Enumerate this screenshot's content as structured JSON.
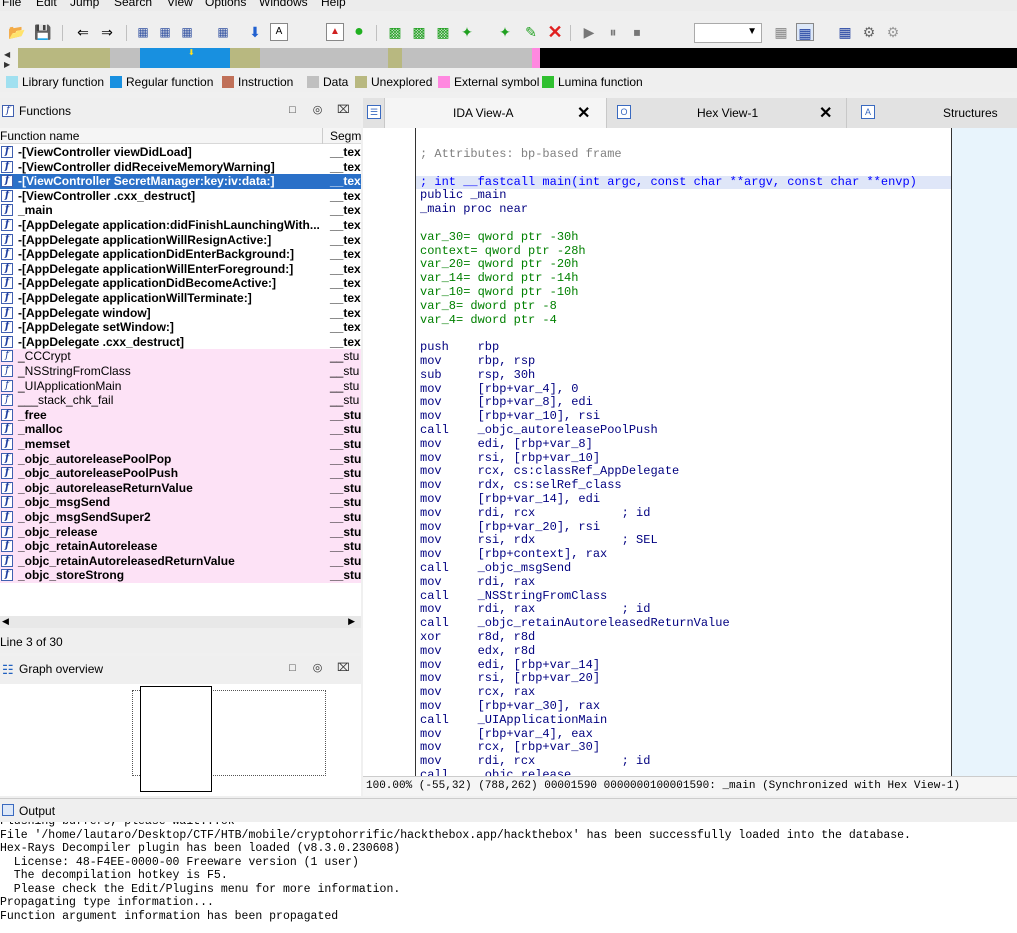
{
  "menu": [
    "File",
    "Edit",
    "Jump",
    "Search",
    "View",
    "Options",
    "Windows",
    "Help"
  ],
  "legend": [
    {
      "label": "Library function",
      "color": "#a0e0f0"
    },
    {
      "label": "Regular function",
      "color": "#1890e0"
    },
    {
      "label": "Instruction",
      "color": "#c07058"
    },
    {
      "label": "Data",
      "color": "#c0c0c0"
    },
    {
      "label": "Unexplored",
      "color": "#b8b880"
    },
    {
      "label": "External symbol",
      "color": "#ff88e0"
    },
    {
      "label": "Lumina function",
      "color": "#30c030"
    }
  ],
  "functions_panel": {
    "title": "Functions",
    "col_name": "Function name",
    "col_segment": "Segm",
    "line_info": "Line 3 of 30",
    "rows": [
      {
        "name": "-[ViewController viewDidLoad]",
        "seg": "__tex",
        "bold": true,
        "ext": false
      },
      {
        "name": "-[ViewController didReceiveMemoryWarning]",
        "seg": "__tex",
        "bold": true,
        "ext": false
      },
      {
        "name": "-[ViewController SecretManager:key:iv:data:]",
        "seg": "__tex",
        "bold": true,
        "ext": false,
        "selected": true
      },
      {
        "name": "-[ViewController .cxx_destruct]",
        "seg": "__tex",
        "bold": true,
        "ext": false
      },
      {
        "name": "_main",
        "seg": "__tex",
        "bold": true,
        "ext": false
      },
      {
        "name": "-[AppDelegate application:didFinishLaunchingWith...",
        "seg": "__tex",
        "bold": true,
        "ext": false
      },
      {
        "name": "-[AppDelegate applicationWillResignActive:]",
        "seg": "__tex",
        "bold": true,
        "ext": false
      },
      {
        "name": "-[AppDelegate applicationDidEnterBackground:]",
        "seg": "__tex",
        "bold": true,
        "ext": false
      },
      {
        "name": "-[AppDelegate applicationWillEnterForeground:]",
        "seg": "__tex",
        "bold": true,
        "ext": false
      },
      {
        "name": "-[AppDelegate applicationDidBecomeActive:]",
        "seg": "__tex",
        "bold": true,
        "ext": false
      },
      {
        "name": "-[AppDelegate applicationWillTerminate:]",
        "seg": "__tex",
        "bold": true,
        "ext": false
      },
      {
        "name": "-[AppDelegate window]",
        "seg": "__tex",
        "bold": true,
        "ext": false
      },
      {
        "name": "-[AppDelegate setWindow:]",
        "seg": "__tex",
        "bold": true,
        "ext": false
      },
      {
        "name": "-[AppDelegate .cxx_destruct]",
        "seg": "__tex",
        "bold": true,
        "ext": false
      },
      {
        "name": "_CCCrypt",
        "seg": "__stu",
        "bold": false,
        "ext": true
      },
      {
        "name": "_NSStringFromClass",
        "seg": "__stu",
        "bold": false,
        "ext": true
      },
      {
        "name": "_UIApplicationMain",
        "seg": "__stu",
        "bold": false,
        "ext": true
      },
      {
        "name": "___stack_chk_fail",
        "seg": "__stu",
        "bold": false,
        "ext": true
      },
      {
        "name": "_free",
        "seg": "__stu",
        "bold": true,
        "ext": true
      },
      {
        "name": "_malloc",
        "seg": "__stu",
        "bold": true,
        "ext": true
      },
      {
        "name": "_memset",
        "seg": "__stu",
        "bold": true,
        "ext": true
      },
      {
        "name": "_objc_autoreleasePoolPop",
        "seg": "__stu",
        "bold": true,
        "ext": true
      },
      {
        "name": "_objc_autoreleasePoolPush",
        "seg": "__stu",
        "bold": true,
        "ext": true
      },
      {
        "name": "_objc_autoreleaseReturnValue",
        "seg": "__stu",
        "bold": true,
        "ext": true
      },
      {
        "name": "_objc_msgSend",
        "seg": "__stu",
        "bold": true,
        "ext": true
      },
      {
        "name": "_objc_msgSendSuper2",
        "seg": "__stu",
        "bold": true,
        "ext": true
      },
      {
        "name": "_objc_release",
        "seg": "__stu",
        "bold": true,
        "ext": true
      },
      {
        "name": "_objc_retainAutorelease",
        "seg": "__stu",
        "bold": true,
        "ext": true
      },
      {
        "name": "_objc_retainAutoreleasedReturnValue",
        "seg": "__stu",
        "bold": true,
        "ext": true
      },
      {
        "name": "_objc_storeStrong",
        "seg": "__stu",
        "bold": true,
        "ext": true
      }
    ]
  },
  "graph_panel": {
    "title": "Graph overview"
  },
  "tabs": [
    {
      "label": "IDA View-A"
    },
    {
      "label": "Hex View-1"
    },
    {
      "label": "Structures"
    }
  ],
  "disasm": {
    "lines": [
      {
        "t": "; Attributes: bp-based frame",
        "c": "cmt"
      },
      {
        "t": "",
        "c": ""
      },
      {
        "t": "; int __fastcall main(int argc, const char **argv, const char **envp)",
        "c": "bl hl"
      },
      {
        "t": "public _main",
        "c": "mn"
      },
      {
        "t": "_main proc near",
        "c": "mn"
      },
      {
        "t": "",
        "c": ""
      },
      {
        "t": "var_30= qword ptr -30h",
        "c": "gr"
      },
      {
        "t": "context= qword ptr -28h",
        "c": "gr"
      },
      {
        "t": "var_20= qword ptr -20h",
        "c": "gr"
      },
      {
        "t": "var_14= dword ptr -14h",
        "c": "gr"
      },
      {
        "t": "var_10= qword ptr -10h",
        "c": "gr"
      },
      {
        "t": "var_8= dword ptr -8",
        "c": "gr"
      },
      {
        "t": "var_4= dword ptr -4",
        "c": "gr"
      },
      {
        "t": "",
        "c": ""
      },
      {
        "t": "push    rbp",
        "c": "mn"
      },
      {
        "t": "mov     rbp, rsp",
        "c": "mn"
      },
      {
        "t": "sub     rsp, 30h",
        "c": "mn"
      },
      {
        "t": "mov     [rbp+var_4], 0",
        "c": "mn"
      },
      {
        "t": "mov     [rbp+var_8], edi",
        "c": "mn"
      },
      {
        "t": "mov     [rbp+var_10], rsi",
        "c": "mn"
      },
      {
        "t": "call    _objc_autoreleasePoolPush",
        "c": "mn"
      },
      {
        "t": "mov     edi, [rbp+var_8]",
        "c": "mn"
      },
      {
        "t": "mov     rsi, [rbp+var_10]",
        "c": "mn"
      },
      {
        "t": "mov     rcx, cs:classRef_AppDelegate",
        "c": "mn"
      },
      {
        "t": "mov     rdx, cs:selRef_class",
        "c": "mn"
      },
      {
        "t": "mov     [rbp+var_14], edi",
        "c": "mn"
      },
      {
        "t": "mov     rdi, rcx            ; id",
        "c": "mn"
      },
      {
        "t": "mov     [rbp+var_20], rsi",
        "c": "mn"
      },
      {
        "t": "mov     rsi, rdx            ; SEL",
        "c": "mn"
      },
      {
        "t": "mov     [rbp+context], rax",
        "c": "mn"
      },
      {
        "t": "call    _objc_msgSend",
        "c": "mn"
      },
      {
        "t": "mov     rdi, rax",
        "c": "mn"
      },
      {
        "t": "call    _NSStringFromClass",
        "c": "mn"
      },
      {
        "t": "mov     rdi, rax            ; id",
        "c": "mn"
      },
      {
        "t": "call    _objc_retainAutoreleasedReturnValue",
        "c": "mn"
      },
      {
        "t": "xor     r8d, r8d",
        "c": "mn"
      },
      {
        "t": "mov     edx, r8d",
        "c": "mn"
      },
      {
        "t": "mov     edi, [rbp+var_14]",
        "c": "mn"
      },
      {
        "t": "mov     rsi, [rbp+var_20]",
        "c": "mn"
      },
      {
        "t": "mov     rcx, rax",
        "c": "mn"
      },
      {
        "t": "mov     [rbp+var_30], rax",
        "c": "mn"
      },
      {
        "t": "call    _UIApplicationMain",
        "c": "mn"
      },
      {
        "t": "mov     [rbp+var_4], eax",
        "c": "mn"
      },
      {
        "t": "mov     rcx, [rbp+var_30]",
        "c": "mn"
      },
      {
        "t": "mov     rdi, rcx            ; id",
        "c": "mn"
      },
      {
        "t": "call    _objc_release",
        "c": "mn"
      }
    ],
    "status": "100.00% (-55,32) (788,262) 00001590 0000000100001590: _main (Synchronized with Hex View-1)"
  },
  "output": {
    "title": "Output",
    "lines": [
      "Flushing buffers, please wait...ok",
      "File '/home/lautaro/Desktop/CTF/HTB/mobile/cryptohorrific/hackthebox.app/hackthebox' has been successfully loaded into the database.",
      "Hex-Rays Decompiler plugin has been loaded (v8.3.0.230608)",
      "  License: 48-F4EE-0000-00 Freeware version (1 user)",
      "  The decompilation hotkey is F5.",
      "  Please check the Edit/Plugins menu for more information.",
      "Propagating type information...",
      "Function argument information has been propagated"
    ]
  }
}
